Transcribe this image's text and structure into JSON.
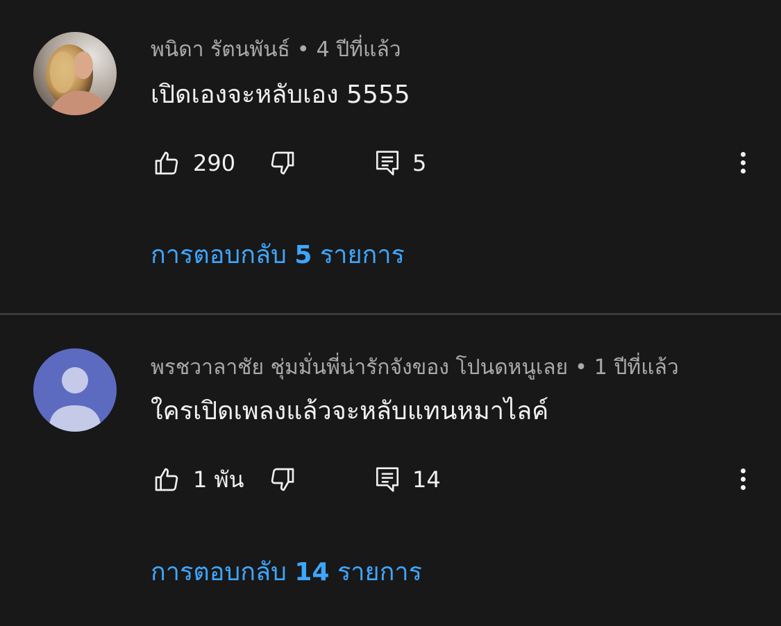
{
  "comments": [
    {
      "author": "พนิดา รัตนพันธ์",
      "time": "4 ปีที่แล้ว",
      "text": "เปิดเองจะหลับเอง 5555",
      "likes": "290",
      "reply_count": "5",
      "replies_prefix": "การตอบกลับ",
      "replies_count": "5",
      "replies_suffix": "รายการ",
      "avatar_icon": "profile-photo"
    },
    {
      "author": "พรชวาลาชัย ชุ่มมั่นพี่น่ารักจังของ โปนดหนูเลย",
      "time": "1 ปีที่แล้ว",
      "text": "ใครเปิดเพลงแล้วจะหลับแทนหมาไลค์",
      "likes": "1 พัน",
      "reply_count": "14",
      "replies_prefix": "การตอบกลับ",
      "replies_count": "14",
      "replies_suffix": "รายการ",
      "avatar_icon": "default-user-avatar",
      "avatar_color": "#5c6bc0"
    }
  ],
  "separator": "•",
  "icons": {
    "like": "thumb-up-icon",
    "dislike": "thumb-down-icon",
    "reply": "comment-reply-icon",
    "more": "more-vertical-icon"
  },
  "colors": {
    "background": "#181818",
    "link": "#3ea6ff",
    "secondary_text": "#aaaaaa"
  }
}
